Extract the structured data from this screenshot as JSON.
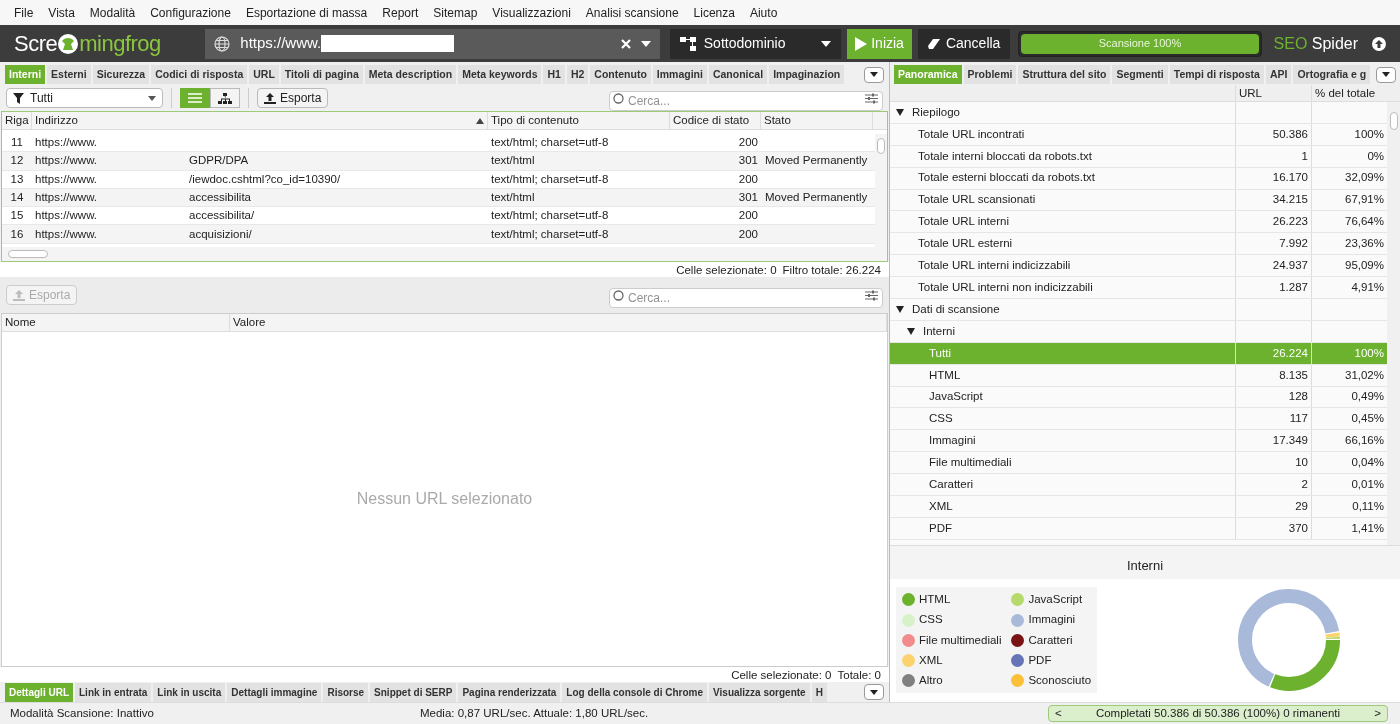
{
  "menu": [
    "File",
    "Vista",
    "Modalità",
    "Configurazione",
    "Esportazione di massa",
    "Report",
    "Sitemap",
    "Visualizzazioni",
    "Analisi scansione",
    "Licenza",
    "Aiuto"
  ],
  "toolbar": {
    "logo_before": "Scre",
    "logo_after": "mingfrog",
    "url": "https://www.",
    "mode": "Sottodominio",
    "start": "Inizia",
    "cancel": "Cancella",
    "progress": {
      "label": "Scansione 100%",
      "level": 1
    },
    "brand_a": "SEO",
    "brand_b": "Spider"
  },
  "left_tabs": [
    {
      "label": "Interni",
      "selected": true
    },
    {
      "label": "Esterni",
      "selected": false
    },
    {
      "label": "Sicurezza",
      "selected": false
    },
    {
      "label": "Codici di risposta",
      "selected": false
    },
    {
      "label": "URL",
      "selected": false
    },
    {
      "label": "Titoli di pagina",
      "selected": false
    },
    {
      "label": "Meta description",
      "selected": false
    },
    {
      "label": "Meta keywords",
      "selected": false
    },
    {
      "label": "H1",
      "selected": false
    },
    {
      "label": "H2",
      "selected": false
    },
    {
      "label": "Contenuto",
      "selected": false
    },
    {
      "label": "Immagini",
      "selected": false
    },
    {
      "label": "Canonical",
      "selected": false
    },
    {
      "label": "Impaginazion",
      "selected": false
    }
  ],
  "filter": "Tutti",
  "view_buttons": [
    {
      "kind": "list",
      "selected": true
    },
    {
      "kind": "tree",
      "selected": false
    }
  ],
  "export": "Esporta",
  "search": {
    "placeholder": "Cerca..."
  },
  "table": {
    "columns": [
      "Riga",
      "Indirizzo",
      "Tipo di contenuto",
      "Codice di stato",
      "Stato"
    ],
    "rows": [
      {
        "riga": "11",
        "prefix": "https://www.",
        "suffix": "",
        "type": "text/html; charset=utf-8",
        "code": "200",
        "status": ""
      },
      {
        "riga": "12",
        "prefix": "https://www.",
        "suffix": "GDPR/DPA",
        "type": "text/html",
        "code": "301",
        "status": "Moved Permanently"
      },
      {
        "riga": "13",
        "prefix": "https://www.",
        "suffix": "/iewdoc.cshtml?co_id=10390/",
        "type": "text/html; charset=utf-8",
        "code": "200",
        "status": ""
      },
      {
        "riga": "14",
        "prefix": "https://www.",
        "suffix": "accessibilita",
        "type": "text/html",
        "code": "301",
        "status": "Moved Permanently"
      },
      {
        "riga": "15",
        "prefix": "https://www.",
        "suffix": "accessibilita/",
        "type": "text/html; charset=utf-8",
        "code": "200",
        "status": ""
      },
      {
        "riga": "16",
        "prefix": "https://www.",
        "suffix": "acquisizioni/",
        "type": "text/html; charset=utf-8",
        "code": "200",
        "status": ""
      }
    ],
    "footer": [
      "Celle selezionate: 0",
      "Filtro totale: 26.224"
    ]
  },
  "details": {
    "export": {
      "label": "Esporta",
      "disabled": true
    },
    "search": {
      "placeholder": "Cerca..."
    },
    "columns": [
      "Nome",
      "Valore"
    ],
    "empty": "Nessun URL selezionato",
    "footer": [
      "Celle selezionate: 0",
      "Totale: 0"
    ]
  },
  "bottom_tabs": [
    {
      "label": "Dettagli URL",
      "selected": true
    },
    {
      "label": "Link in entrata",
      "selected": false
    },
    {
      "label": "Link in uscita",
      "selected": false
    },
    {
      "label": "Dettagli immagine",
      "selected": false
    },
    {
      "label": "Risorse",
      "selected": false
    },
    {
      "label": "Snippet di SERP",
      "selected": false
    },
    {
      "label": "Pagina renderizzata",
      "selected": false
    },
    {
      "label": "Log della console di Chrome",
      "selected": false
    },
    {
      "label": "Visualizza sorgente",
      "selected": false
    },
    {
      "label": "H",
      "selected": false
    }
  ],
  "status_bar": {
    "mode": "Modalità Scansione: Inattivo",
    "speed": "Media: 0,87 URL/sec. Attuale: 1,80 URL/sec.",
    "progress": "Completati 50.386 di 50.386 (100%) 0 rimanenti",
    "left_arrow": "<",
    "right_arrow": ">"
  },
  "right_tabs": [
    {
      "label": "Panoramica",
      "selected": true
    },
    {
      "label": "Problemi",
      "selected": false
    },
    {
      "label": "Struttura del sito",
      "selected": false
    },
    {
      "label": "Segmenti",
      "selected": false
    },
    {
      "label": "Tempi di risposta",
      "selected": false
    },
    {
      "label": "API",
      "selected": false
    },
    {
      "label": "Ortografia e g",
      "selected": false
    }
  ],
  "overview": {
    "columns": [
      "URL",
      "% del totale"
    ],
    "tree": [
      {
        "label": "Riepilogo",
        "expanded": true,
        "children": [
          {
            "label": "Totale URL incontrati",
            "url": "50.386",
            "pct": "100%",
            "selected": false
          },
          {
            "label": "Totale interni bloccati da robots.txt",
            "url": "1",
            "pct": "0%",
            "selected": false
          },
          {
            "label": "Totale esterni bloccati da robots.txt",
            "url": "16.170",
            "pct": "32,09%",
            "selected": false
          },
          {
            "label": "Totale URL scansionati",
            "url": "34.215",
            "pct": "67,91%",
            "selected": false
          },
          {
            "label": "Totale URL interni",
            "url": "26.223",
            "pct": "76,64%",
            "selected": false
          },
          {
            "label": "Totale URL esterni",
            "url": "7.992",
            "pct": "23,36%",
            "selected": false
          },
          {
            "label": "Totale URL interni indicizzabili",
            "url": "24.937",
            "pct": "95,09%",
            "selected": false
          },
          {
            "label": "Totale URL interni non indicizzabili",
            "url": "1.287",
            "pct": "4,91%",
            "selected": false
          }
        ]
      },
      {
        "label": "Dati di scansione",
        "expanded": true,
        "children": [
          {
            "label": "Interni",
            "expanded": true,
            "children": [
              {
                "label": "Tutti",
                "url": "26.224",
                "pct": "100%",
                "selected": true
              },
              {
                "label": "HTML",
                "url": "8.135",
                "pct": "31,02%",
                "selected": false
              },
              {
                "label": "JavaScript",
                "url": "128",
                "pct": "0,49%",
                "selected": false
              },
              {
                "label": "CSS",
                "url": "117",
                "pct": "0,45%",
                "selected": false
              },
              {
                "label": "Immagini",
                "url": "17.349",
                "pct": "66,16%",
                "selected": false
              },
              {
                "label": "File multimediali",
                "url": "10",
                "pct": "0,04%",
                "selected": false
              },
              {
                "label": "Caratteri",
                "url": "2",
                "pct": "0,01%",
                "selected": false
              },
              {
                "label": "XML",
                "url": "29",
                "pct": "0,11%",
                "selected": false
              },
              {
                "label": "PDF",
                "url": "370",
                "pct": "1,41%",
                "selected": false
              }
            ]
          }
        ]
      }
    ]
  },
  "chart": {
    "title": "Interni",
    "legend": [
      {
        "label": "HTML",
        "color": "#6cb22f"
      },
      {
        "label": "JavaScript",
        "color": "#b5d96a"
      },
      {
        "label": "CSS",
        "color": "#d7f2c8"
      },
      {
        "label": "Immagini",
        "color": "#a9b9da"
      },
      {
        "label": "File multimediali",
        "color": "#f28b8b"
      },
      {
        "label": "Caratteri",
        "color": "#7a1414"
      },
      {
        "label": "XML",
        "color": "#fcd26e"
      },
      {
        "label": "PDF",
        "color": "#6674b8"
      },
      {
        "label": "Altro",
        "color": "#808080"
      },
      {
        "label": "Sconosciuto",
        "color": "#fbbf3a"
      }
    ]
  }
}
